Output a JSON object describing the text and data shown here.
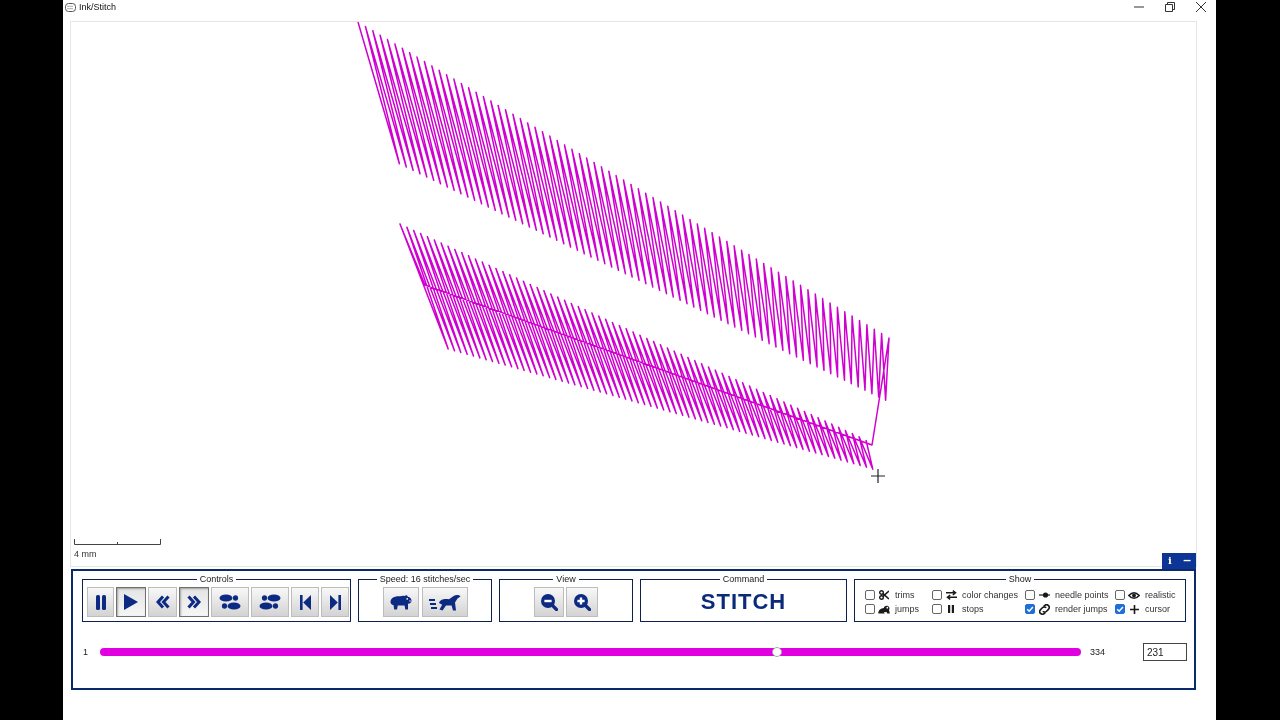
{
  "window": {
    "title": "Ink/Stitch"
  },
  "canvas": {
    "scale_label": "4 mm"
  },
  "panel_buttons": [
    {
      "kind": "info",
      "label": "i"
    },
    {
      "kind": "collapse",
      "label": "−"
    }
  ],
  "controls": {
    "label": "Controls",
    "buttons": [
      {
        "kind": "pause",
        "pressed": false
      },
      {
        "kind": "play",
        "pressed": true
      },
      {
        "kind": "reverse",
        "pressed": false
      },
      {
        "kind": "forward",
        "pressed": true
      },
      {
        "kind": "step_back",
        "pressed": false
      },
      {
        "kind": "step_forward",
        "pressed": false
      },
      {
        "kind": "restart",
        "pressed": false
      },
      {
        "kind": "end",
        "pressed": false
      }
    ]
  },
  "speed": {
    "label": "Speed: 16 stitches/sec",
    "buttons": [
      {
        "kind": "slower"
      },
      {
        "kind": "faster"
      }
    ]
  },
  "view": {
    "label": "View",
    "buttons": [
      {
        "kind": "zoom_out"
      },
      {
        "kind": "zoom_in"
      }
    ]
  },
  "command": {
    "label": "Command",
    "value": "STITCH"
  },
  "show": {
    "label": "Show",
    "options": [
      {
        "kind": "trims",
        "label": "trims",
        "checked": false
      },
      {
        "kind": "color_changes",
        "label": "color changes",
        "checked": false
      },
      {
        "kind": "needle_points",
        "label": "needle points",
        "checked": false
      },
      {
        "kind": "realistic",
        "label": "realistic",
        "checked": false
      },
      {
        "kind": "jumps",
        "label": "jumps",
        "checked": false
      },
      {
        "kind": "stops",
        "label": "stops",
        "checked": false
      },
      {
        "kind": "render_jumps",
        "label": "render jumps",
        "checked": true
      },
      {
        "kind": "cursor",
        "label": "cursor",
        "checked": true
      }
    ]
  },
  "timeline": {
    "start": "1",
    "end": "334",
    "level": 0.69,
    "value": "231"
  }
}
